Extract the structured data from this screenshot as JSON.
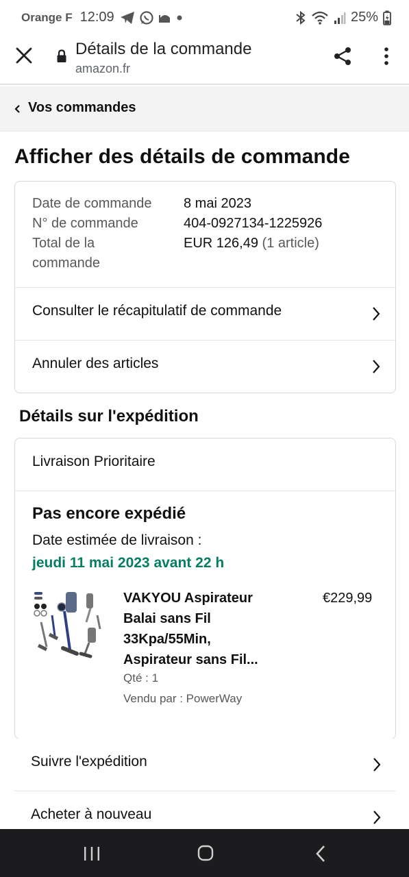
{
  "status_bar": {
    "carrier": "Orange F",
    "time": "12:09",
    "battery": "25%"
  },
  "browser": {
    "page_title": "Détails de la commande",
    "domain": "amazon.fr"
  },
  "breadcrumb": {
    "label": "Vos commandes"
  },
  "main": {
    "title": "Afficher des détails de commande",
    "order_summary": {
      "date_label": "Date de commande",
      "date_value": "8 mai 2023",
      "number_label": "N° de commande",
      "number_value": "404-0927134-1225926",
      "total_label_1": "Total de la",
      "total_label_2": "commande",
      "total_value": "EUR 126,49",
      "total_items": "(1 article)"
    },
    "order_links": [
      {
        "label": "Consulter le récapitulatif de commande"
      },
      {
        "label": "Annuler des articles"
      }
    ],
    "shipping_section_title": "Détails sur l'expédition",
    "shipment": {
      "method": "Livraison Prioritaire",
      "status": "Pas encore expédié",
      "estimate_label": "Date estimée de livraison :",
      "estimate_date": "jeudi 11 mai 2023 avant 22 h",
      "product": {
        "title_lines": [
          "VAKYOU Aspirateur",
          "Balai sans Fil",
          "33Kpa/55Min,",
          "Aspirateur sans Fil..."
        ],
        "price": "€229,99",
        "quantity": "Qté : 1",
        "seller": "Vendu par : PowerWay"
      }
    },
    "shipment_links": [
      {
        "label": "Suivre l'expédition"
      },
      {
        "label": "Acheter à nouveau"
      }
    ]
  },
  "colors": {
    "delivery_green": "#067d62",
    "text": "#0f1111",
    "muted": "#565959",
    "nav_bar": "#1c1c1e"
  }
}
